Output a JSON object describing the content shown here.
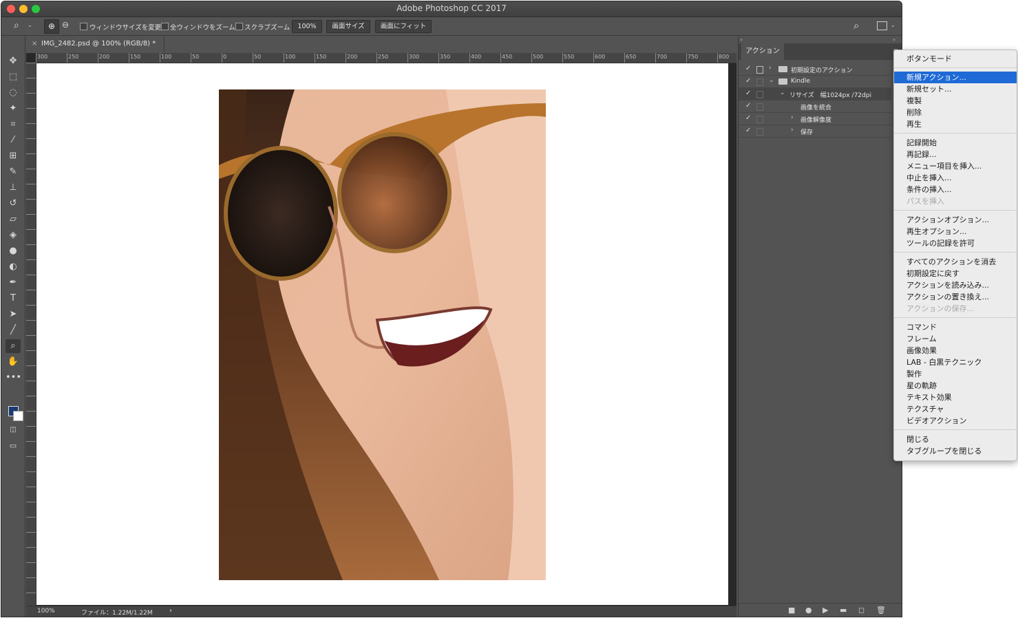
{
  "app": {
    "title": "Adobe Photoshop CC 2017"
  },
  "options_bar": {
    "resize_windows": "ウィンドウサイズを変更",
    "zoom_all_windows": "全ウィンドウをズーム",
    "scrubby_zoom": "スクラブズーム",
    "zoom_value": "100%",
    "fit_screen": "画面サイズ",
    "fill_screen": "画面にフィット"
  },
  "document": {
    "tab_title": "IMG_2482.psd @ 100% (RGB/8) *",
    "close_glyph": "×"
  },
  "ruler": {
    "h_ticks": [
      "300",
      "250",
      "200",
      "150",
      "100",
      "50",
      "0",
      "50",
      "100",
      "150",
      "200",
      "250",
      "300",
      "350",
      "400",
      "450",
      "500",
      "550",
      "600",
      "650",
      "700",
      "750",
      "800"
    ]
  },
  "status": {
    "zoom": "100%",
    "file": "ファイル：1.22M/1.22M",
    "arrow": "›"
  },
  "actions_panel": {
    "tab": "アクション",
    "rows": [
      {
        "label": "初期設定のアクション",
        "kind": "set",
        "expanded": false
      },
      {
        "label": "Kindle",
        "kind": "set",
        "expanded": true
      },
      {
        "label": "リサイズ　幅1024px /72dpi",
        "kind": "action",
        "expanded": true
      },
      {
        "label": "画像を統合",
        "kind": "step"
      },
      {
        "label": "画像解像度",
        "kind": "step"
      },
      {
        "label": "保存",
        "kind": "step"
      }
    ]
  },
  "panel_menu": {
    "groups": [
      [
        {
          "label": "ボタンモード"
        }
      ],
      [
        {
          "label": "新規アクション...",
          "selected": true
        },
        {
          "label": "新規セット..."
        },
        {
          "label": "複製"
        },
        {
          "label": "削除"
        },
        {
          "label": "再生"
        }
      ],
      [
        {
          "label": "記録開始"
        },
        {
          "label": "再記録..."
        },
        {
          "label": "メニュー項目を挿入..."
        },
        {
          "label": "中止を挿入..."
        },
        {
          "label": "条件の挿入..."
        },
        {
          "label": "パスを挿入",
          "disabled": true
        }
      ],
      [
        {
          "label": "アクションオプション..."
        },
        {
          "label": "再生オプション..."
        },
        {
          "label": "ツールの記録を許可"
        }
      ],
      [
        {
          "label": "すべてのアクションを消去"
        },
        {
          "label": "初期設定に戻す"
        },
        {
          "label": "アクションを読み込み..."
        },
        {
          "label": "アクションの置き換え..."
        },
        {
          "label": "アクションの保存...",
          "disabled": true
        }
      ],
      [
        {
          "label": "コマンド"
        },
        {
          "label": "フレーム"
        },
        {
          "label": "画像効果"
        },
        {
          "label": "LAB - 白黒テクニック"
        },
        {
          "label": "製作"
        },
        {
          "label": "星の軌跡"
        },
        {
          "label": "テキスト効果"
        },
        {
          "label": "テクスチャ"
        },
        {
          "label": "ビデオアクション"
        }
      ],
      [
        {
          "label": "閉じる"
        },
        {
          "label": "タブグループを閉じる"
        }
      ]
    ]
  },
  "colors": {
    "foreground": "#1a3a73",
    "background": "#ffffff",
    "accent": "#1f6ad6"
  },
  "icons": [
    "move-icon",
    "marquee-icon",
    "lasso-icon",
    "magic-wand-icon",
    "crop-icon",
    "eyedropper-icon",
    "patch-icon",
    "brush-icon",
    "stamp-icon",
    "history-brush-icon",
    "eraser-icon",
    "bucket-icon",
    "blur-icon",
    "dodge-icon",
    "pen-icon",
    "type-icon",
    "path-select-icon",
    "line-icon",
    "zoom-icon",
    "hand-icon",
    "more-icon"
  ]
}
